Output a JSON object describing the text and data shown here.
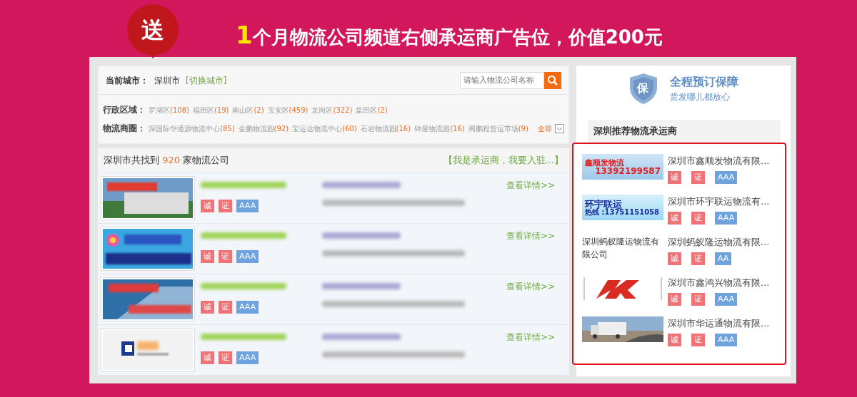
{
  "promo": {
    "badge": "送",
    "headline_number": "1",
    "headline": "个月物流公司频道右侧承运商广告位，价值200元"
  },
  "filters": {
    "city_label": "当前城市：",
    "city": "深圳市",
    "switch_link": "[切换城市]",
    "search": {
      "placeholder": "请输入物流公司名称"
    },
    "rows": [
      {
        "label": "行政区域：",
        "items": [
          {
            "name": "罗湖区",
            "count": "(108)"
          },
          {
            "name": "福田区",
            "count": "(19)"
          },
          {
            "name": "南山区",
            "count": "(2)"
          },
          {
            "name": "宝安区",
            "count": "(459)"
          },
          {
            "name": "龙岗区",
            "count": "(322)"
          },
          {
            "name": "盐田区",
            "count": "(2)"
          }
        ]
      },
      {
        "label": "物流商圈：",
        "items": [
          {
            "name": "深国际华通源物流中心",
            "count": "(85)"
          },
          {
            "name": "金鹏物流园",
            "count": "(92)"
          },
          {
            "name": "宝运达物流中心",
            "count": "(60)"
          },
          {
            "name": "石岩物流园",
            "count": "(16)"
          },
          {
            "name": "钟屋物流园",
            "count": "(16)"
          },
          {
            "name": "闽鹏程货运市场",
            "count": "(9)"
          }
        ],
        "more": "全部"
      }
    ]
  },
  "results": {
    "prefix": "深圳市共找到",
    "count": "920",
    "suffix": "家物流公司",
    "join_link": "【我是承运商，我要入驻...】",
    "rows": [
      {
        "kind": "truck",
        "badges": [
          "诚",
          "证",
          "AAA"
        ],
        "details": "查看详情>>"
      },
      {
        "kind": "flower",
        "badges": [
          "诚",
          "证",
          "AAA"
        ],
        "details": "查看详情>>"
      },
      {
        "kind": "building",
        "badges": [
          "诚",
          "证",
          "AAA"
        ],
        "details": "查看详情>>"
      },
      {
        "kind": "logo",
        "badges": [
          "诚",
          "证",
          "AAA"
        ],
        "details": "查看详情>>"
      }
    ]
  },
  "sidebar": {
    "guarantee_title": "全程预订保障",
    "guarantee_subtitle": "货发哪儿都放心",
    "shield_text": "保",
    "heading": "深圳推荐物流承运商",
    "carriers": [
      {
        "kind": "banner",
        "banner": [
          "鑫顺发物流",
          "13392199587"
        ],
        "name": "深圳市鑫顺发物流有限...",
        "badges": [
          "诚",
          "证",
          "AAA"
        ]
      },
      {
        "kind": "banner2",
        "banner": [
          "环宇联运",
          "热线 :13751151058"
        ],
        "name": "深圳市环宇联运物流有...",
        "badges": [
          "诚",
          "证",
          "AAA"
        ]
      },
      {
        "kind": "text",
        "banner": [
          "深圳蚂蚁隆运物流有限公司"
        ],
        "name": "深圳蚂蚁隆运物流有限...",
        "badges": [
          "诚",
          "证",
          "AA"
        ]
      },
      {
        "kind": "logo",
        "name": "深圳市鑫鸿兴物流有限...",
        "badges": [
          "诚",
          "证",
          "AAA"
        ]
      },
      {
        "kind": "picture",
        "name": "深圳市华运通物流有限...",
        "badges": [
          "诚",
          "证",
          "AAA"
        ]
      }
    ]
  }
}
